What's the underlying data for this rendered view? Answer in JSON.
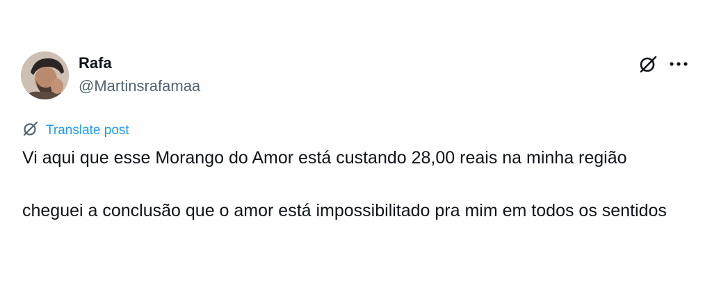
{
  "author": {
    "display_name": "Rafa",
    "handle": "@Martinsrafamaa",
    "avatar_icon": "user-avatar-photo"
  },
  "actions": {
    "grok_icon": "grok-icon",
    "more_icon": "more-horizontal-icon"
  },
  "translate": {
    "label": "Translate post",
    "icon": "grok-icon"
  },
  "post": {
    "paragraphs": [
      "Vi aqui que esse Morango do Amor está custando 28,00 reais na minha região",
      "cheguei a conclusão que o amor está impossibilitado pra mim em todos os sentidos"
    ]
  },
  "colors": {
    "text": "#0f1419",
    "secondary": "#536471",
    "link": "#1d9bf0",
    "background": "#ffffff"
  }
}
